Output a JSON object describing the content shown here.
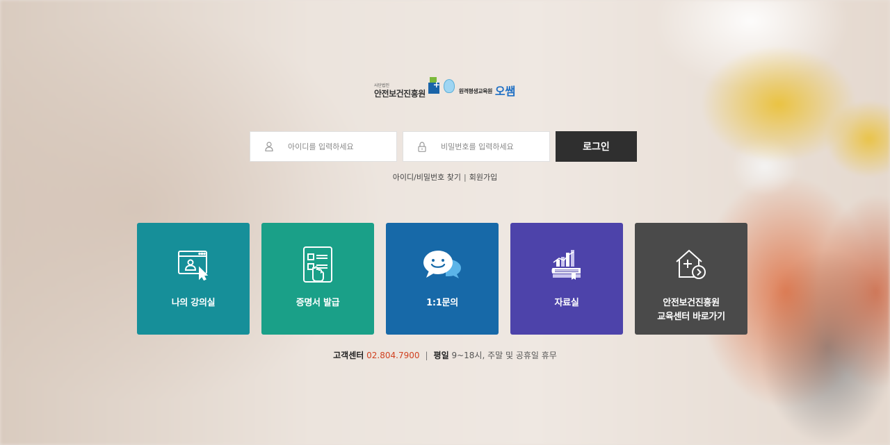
{
  "logo": {
    "org_small": "사단법인",
    "org_name": "안전보건진흥원",
    "sub_name": "원격평생교육원",
    "brand": "오쌤"
  },
  "login": {
    "id_placeholder": "아이디를 입력하세요",
    "pw_placeholder": "비밀번호를 입력하세요",
    "button_label": "로그인",
    "find_link": "아이디/비밀번호 찾기",
    "separator": "|",
    "signup_link": "회원가입"
  },
  "tiles": [
    {
      "label": "나의 강의실",
      "color": "#168f99",
      "icon": "classroom-icon"
    },
    {
      "label": "증명서 발급",
      "color": "#1aa088",
      "icon": "certificate-icon"
    },
    {
      "label": "1:1문의",
      "color": "#1769a8",
      "icon": "chat-icon"
    },
    {
      "label": "자료실",
      "color": "#4d43aa",
      "icon": "library-icon"
    },
    {
      "label_line1": "안전보건진흥원",
      "label_line2": "교육센터 바로가기",
      "color": "#4a4a4a",
      "icon": "home-link-icon"
    }
  ],
  "footer": {
    "center_label": "고객센터",
    "phone": "02.804.7900",
    "separator": "|",
    "hours_label": "평일",
    "hours_text": "9~18시, 주말 및 공휴일 휴무"
  }
}
